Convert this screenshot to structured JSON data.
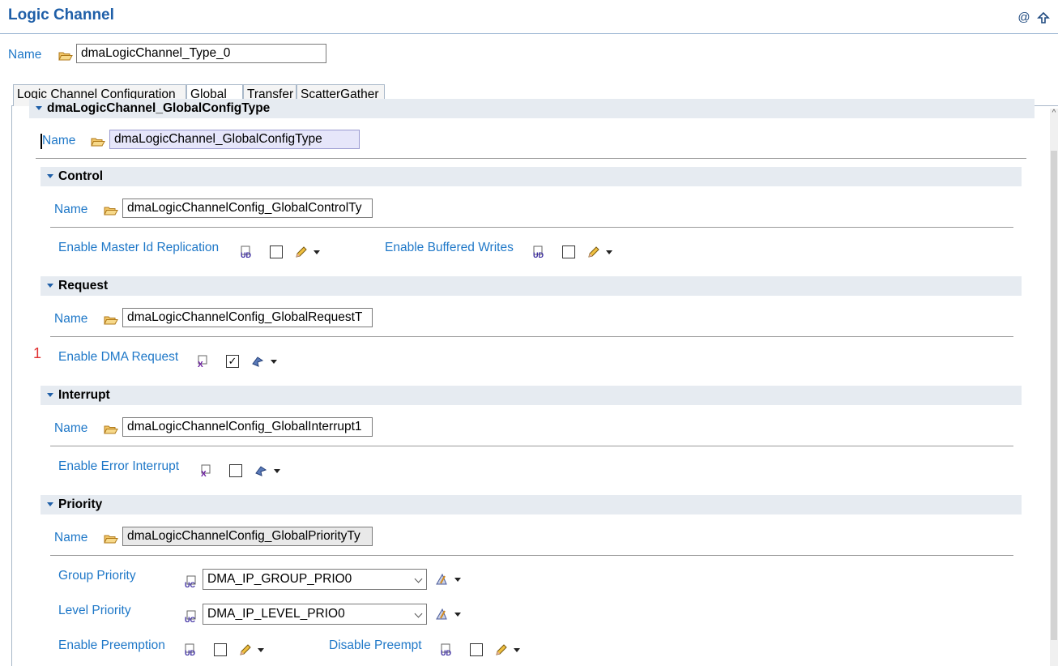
{
  "header": {
    "title": "Logic Channel",
    "name_label": "Name",
    "name_value": "dmaLogicChannel_Type_0"
  },
  "tabs": [
    {
      "label": "Logic Channel Configuration"
    },
    {
      "label": "Global"
    },
    {
      "label": "Transfer"
    },
    {
      "label": "ScatterGather"
    }
  ],
  "active_tab": "Global",
  "global": {
    "header_title": "dmaLogicChannel_GlobalConfigType",
    "name_label": "Name",
    "name_value": "dmaLogicChannel_GlobalConfigType",
    "control": {
      "title": "Control",
      "name_label": "Name",
      "name_value": "dmaLogicChannelConfig_GlobalControlTy",
      "enable_master_id_replication_label": "Enable Master Id Replication",
      "enable_master_id_replication": false,
      "enable_buffered_writes_label": "Enable Buffered Writes",
      "enable_buffered_writes": false
    },
    "request": {
      "title": "Request",
      "name_label": "Name",
      "name_value": "dmaLogicChannelConfig_GlobalRequestT",
      "marker": "1",
      "enable_dma_request_label": "Enable DMA Request",
      "enable_dma_request": true
    },
    "interrupt": {
      "title": "Interrupt",
      "name_label": "Name",
      "name_value": "dmaLogicChannelConfig_GlobalInterrupt1",
      "enable_error_interrupt_label": "Enable Error Interrupt",
      "enable_error_interrupt": false
    },
    "priority": {
      "title": "Priority",
      "name_label": "Name",
      "name_value": "dmaLogicChannelConfig_GlobalPriorityTy",
      "group_priority_label": "Group Priority",
      "group_priority_value": "DMA_IP_GROUP_PRIO0",
      "level_priority_label": "Level Priority",
      "level_priority_value": "DMA_IP_LEVEL_PRIO0",
      "enable_preemption_label": "Enable Preemption",
      "enable_preemption": false,
      "disable_preempt_label": "Disable Preempt",
      "disable_preempt": false
    }
  },
  "colors": {
    "label_blue": "#1f78c8",
    "title_blue": "#1f5fa8",
    "section_bg": "#e6ebf1",
    "marker_red": "#e03030"
  }
}
